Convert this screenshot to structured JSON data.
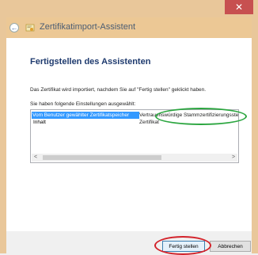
{
  "window": {
    "close_glyph": "✕",
    "title": "Zertifikatimport-Assistent",
    "back_glyph": "←"
  },
  "page": {
    "heading": "Fertigstellen des Assistenten",
    "description": "Das Zertifikat wird importiert, nachdem Sie auf \"Fertig stellen\" geklickt haben.",
    "settings_label": "Sie haben folgende Einstellungen ausgewählt:"
  },
  "settings": {
    "rows": [
      {
        "key": "Vom Benutzer gewählter Zertifikatspeicher",
        "value": "Vertrauenswürdige Stammzertifizierungsstellen",
        "selected": true
      },
      {
        "key": "Inhalt",
        "value": "Zertifikat",
        "selected": false
      }
    ]
  },
  "scrollbar": {
    "left_glyph": "<",
    "right_glyph": ">"
  },
  "buttons": {
    "finish": "Fertig stellen",
    "cancel": "Abbrechen"
  },
  "colors": {
    "accent_selection": "#3399ff",
    "annotation_green": "#2ca640",
    "annotation_red": "#d3222a",
    "heading": "#1e3a6e"
  }
}
